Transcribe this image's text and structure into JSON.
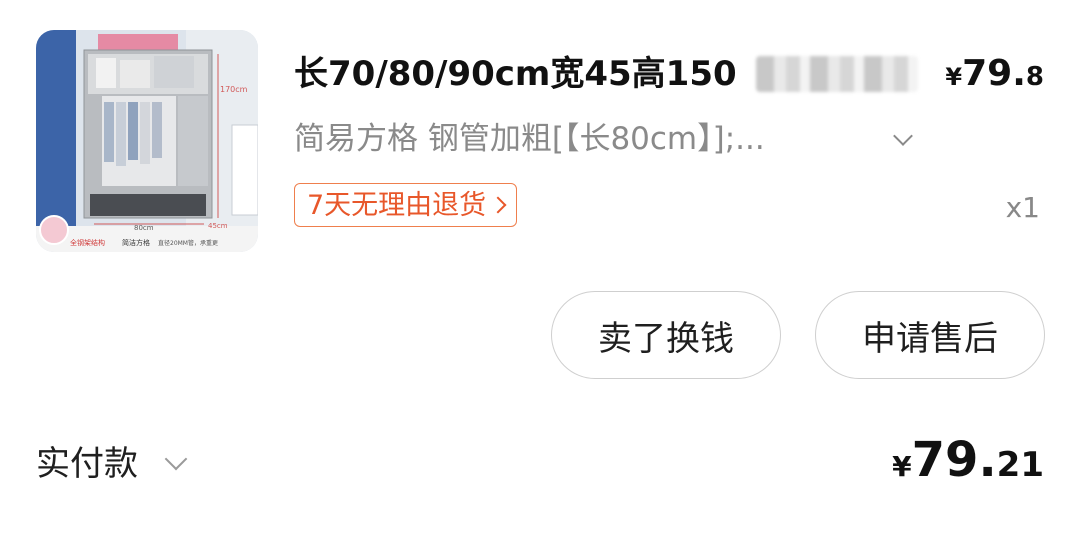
{
  "product": {
    "image_name": "wardrobe-product-image",
    "image_labels": {
      "height": "170cm",
      "width": "80cm",
      "depth": "45cm",
      "footer_left": "全钢架结构",
      "footer_mid": "简洁方格",
      "footer_right": "直径20MM管，承重更"
    },
    "title": "长70/80/90cm宽45高150",
    "unit_price": {
      "currency": "¥",
      "integer": "79.",
      "decimal": "8"
    },
    "spec": "简易方格 钢管加粗[【长80cm】];...",
    "return_badge": "7天无理由退货",
    "quantity": "x1"
  },
  "actions": {
    "sell_label": "卖了换钱",
    "after_sales_label": "申请售后"
  },
  "payment": {
    "label": "实付款",
    "amount": {
      "currency": "¥",
      "integer": "79.",
      "decimal": "21"
    }
  },
  "colors": {
    "badge_orange": "#e8572a",
    "secondary_text": "#8a8a8a",
    "button_border": "#cfcfcf"
  }
}
